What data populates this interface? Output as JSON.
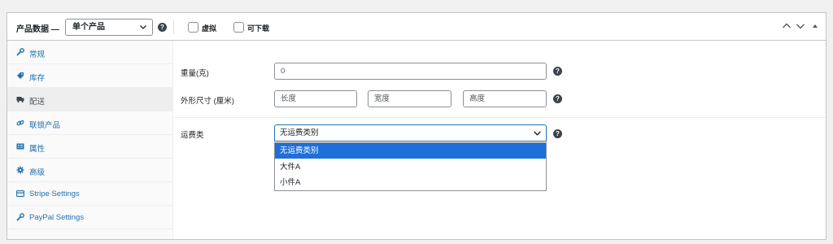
{
  "header": {
    "title": "产品数据 —",
    "product_type": "单个产品",
    "checkbox_virtual": "虚拟",
    "checkbox_downloadable": "可下载"
  },
  "sidebar": {
    "items": [
      {
        "label": "常规",
        "icon": "wrench-icon"
      },
      {
        "label": "库存",
        "icon": "tag-icon"
      },
      {
        "label": "配送",
        "icon": "truck-icon"
      },
      {
        "label": "联锁产品",
        "icon": "link-icon"
      },
      {
        "label": "属性",
        "icon": "list-icon"
      },
      {
        "label": "高级",
        "icon": "gear-icon"
      },
      {
        "label": "Stripe Settings",
        "icon": "card-icon"
      },
      {
        "label": "PayPal Settings",
        "icon": "wrench-icon"
      }
    ],
    "active": "配送"
  },
  "shipping": {
    "weight_label": "重量(克)",
    "weight_value": "0",
    "dimensions_label": "外形尺寸 (厘米)",
    "length_placeholder": "长度",
    "width_placeholder": "宽度",
    "height_placeholder": "高度",
    "class_label": "运费类",
    "class_selected": "无运费类别",
    "class_options": [
      "无运费类别",
      "大件A",
      "小件A"
    ]
  },
  "colors": {
    "link": "#2271b1",
    "selected_option": "#1e6fd9",
    "border": "#c3c4c7"
  }
}
